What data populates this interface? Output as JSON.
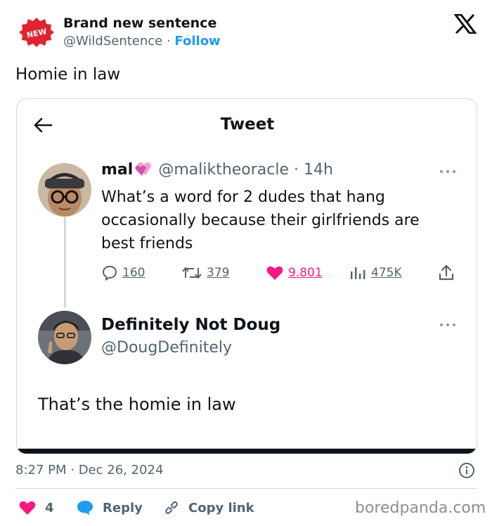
{
  "embed": {
    "avatar_badge": "NEW",
    "author_name": "Brand new sentence",
    "author_handle": "@WildSentence",
    "separator": " · ",
    "follow_label": "Follow",
    "text": "Homie in law",
    "timestamp": "8:27 PM · Dec 26, 2024",
    "likes": "4",
    "reply_label": "Reply",
    "copy_link_label": "Copy link",
    "watermark": "boredpanda.com"
  },
  "screenshot": {
    "title": "Tweet",
    "tweet1": {
      "name": "mal",
      "handle_time": "@maliktheoracle · 14h",
      "text": "What’s a word for 2 dudes that hang occasionally because their girlfriends are best friends",
      "replies": "160",
      "retweets": "379",
      "likes": "9.801",
      "views": "475K"
    },
    "tweet2": {
      "name": "Definitely Not Doug",
      "handle": "@DougDefinitely",
      "text": "That’s the homie in law"
    }
  },
  "colors": {
    "accent_blue": "#1d9bf0",
    "like_pink": "#f91880",
    "muted_text": "#536471",
    "badge_red": "#e0232e"
  }
}
